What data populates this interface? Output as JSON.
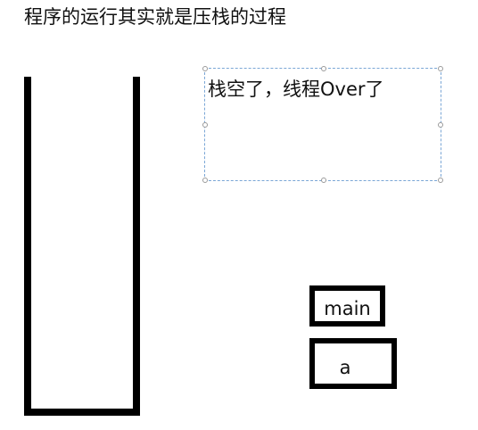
{
  "title": "程序的运行其实就是压栈的过程",
  "note": "栈空了，线程Over了",
  "frames": [
    {
      "label": "main"
    },
    {
      "label": "a"
    }
  ],
  "colors": {
    "stroke": "#000000",
    "selection_border": "#7aa6d6",
    "text": "#111111"
  }
}
